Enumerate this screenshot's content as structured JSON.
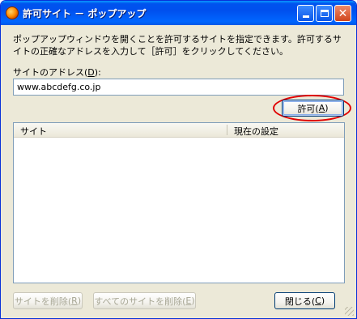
{
  "window": {
    "title": "許可サイト － ポップアップ",
    "controls": {
      "minimize": "minimize-icon",
      "maximize": "maximize-icon",
      "close": "close-icon"
    }
  },
  "description": "ポップアップウィンドウを開くことを許可するサイトを指定できます。許可するサイトの正確なアドレスを入力して［許可］をクリックしてください。",
  "address": {
    "label_text": "サイトのアドレス(",
    "label_accel": "D",
    "label_end": "):",
    "value": "www.abcdefg.co.jp"
  },
  "allow_button": {
    "text": "許可(",
    "accel": "A",
    "end": ")"
  },
  "site_list": {
    "columns": [
      "サイト",
      "現在の設定"
    ],
    "rows": []
  },
  "buttons": {
    "remove": {
      "text": "サイトを削除(",
      "accel": "R",
      "end": ")"
    },
    "remove_all": {
      "text": "すべてのサイトを削除(",
      "accel": "E",
      "end": ")"
    },
    "close": {
      "text": "閉じる(",
      "accel": "C",
      "end": ")"
    }
  },
  "colors": {
    "titlebar": "#0053ee",
    "highlight_ellipse": "#e00000",
    "dialog_bg": "#ece9d8"
  }
}
